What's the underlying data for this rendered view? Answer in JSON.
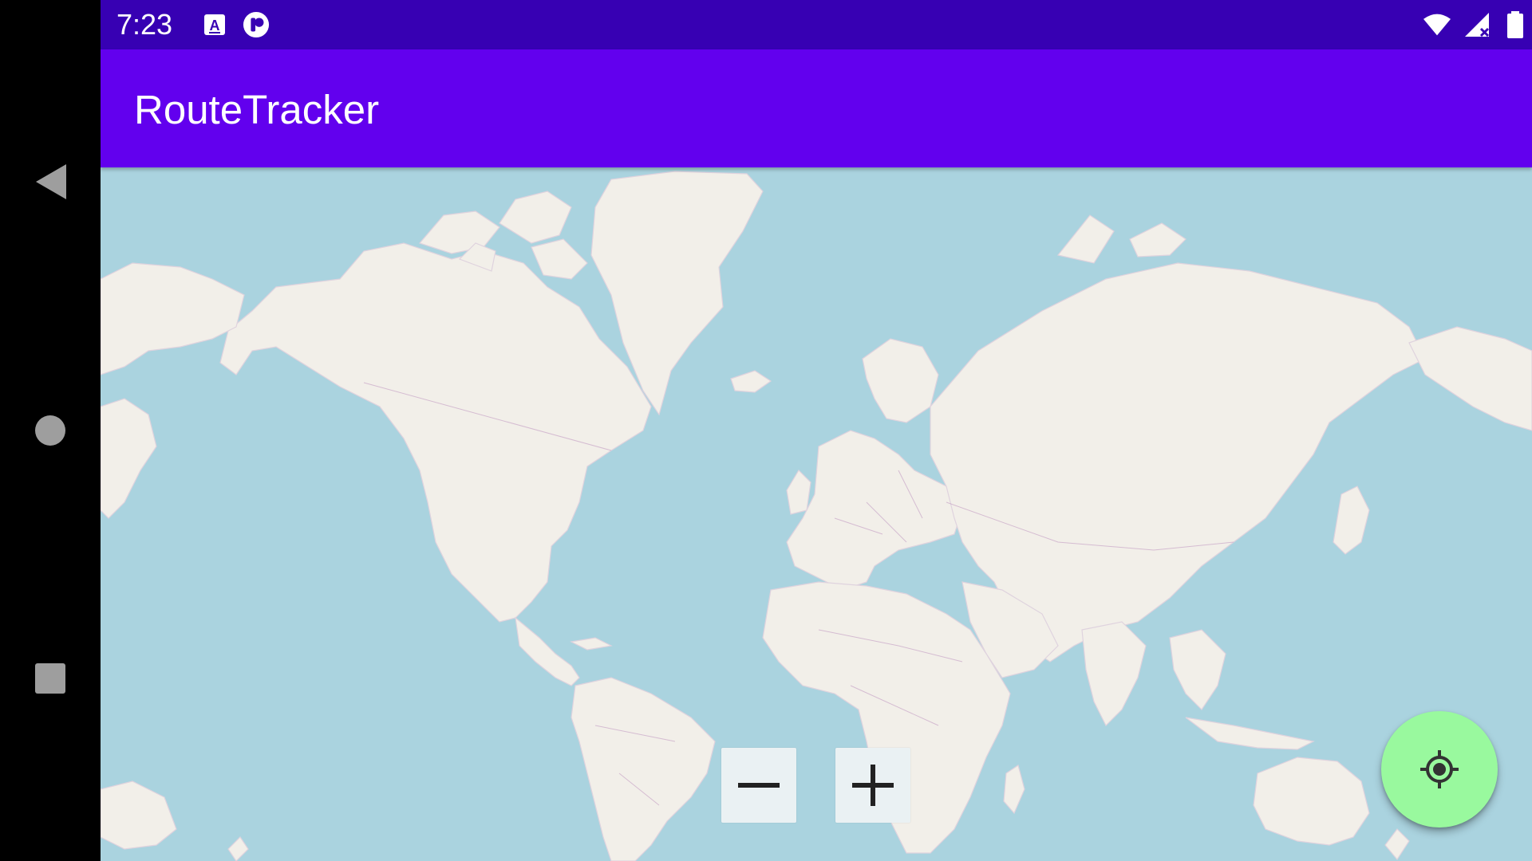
{
  "status_bar": {
    "time": "7:23",
    "left_icons": [
      "keyboard-a-icon",
      "app-notification-icon"
    ],
    "right_icons": [
      "wifi-icon",
      "cell-signal-no-data-icon",
      "battery-icon"
    ]
  },
  "app_bar": {
    "title": "RouteTracker"
  },
  "map": {
    "zoom_out_icon": "minus-icon",
    "zoom_in_icon": "plus-icon",
    "water_color": "#aad3df",
    "land_color": "#f2efe9",
    "border_color": "#c9a7c7"
  },
  "fab": {
    "icon": "my-location-icon",
    "color": "#99f99e"
  },
  "navigation": {
    "items": [
      "back-icon",
      "home-icon",
      "recents-icon"
    ]
  },
  "colors": {
    "status_bar": "#3700b3",
    "app_bar": "#6200ee"
  }
}
